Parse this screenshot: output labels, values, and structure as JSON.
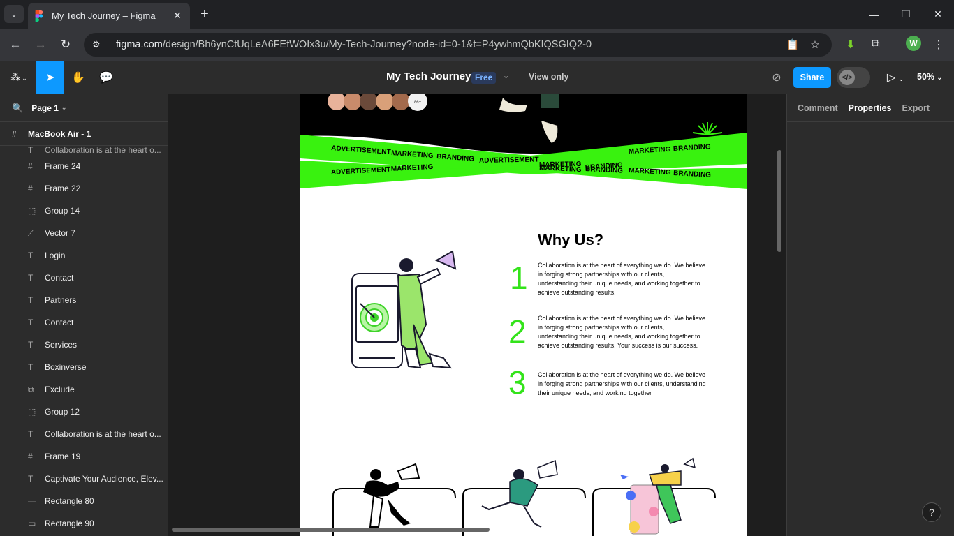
{
  "browser": {
    "tab_title": "My Tech Journey – Figma",
    "url_host": "figma.com",
    "url_path": "/design/Bh6ynCtUqLeA6FEfWOIx3u/My-Tech-Journey?node-id=0-1&t=P4ywhmQbKIQSGIQ2-0",
    "profile_initial": "W"
  },
  "figma": {
    "file_title": "My Tech Journey",
    "plan_badge": "Free",
    "view_mode": "View only",
    "share_label": "Share",
    "zoom": "50%",
    "accent_color": "#0d99ff"
  },
  "left_panel": {
    "page": "Page 1",
    "frame": "MacBook Air - 1",
    "cut_layer": "Collaboration is at the heart o...",
    "layers": [
      {
        "icon": "frame-icon",
        "label": "Frame 24"
      },
      {
        "icon": "frame-icon",
        "label": "Frame 22"
      },
      {
        "icon": "group-icon",
        "label": "Group 14"
      },
      {
        "icon": "vector-icon",
        "label": "Vector 7"
      },
      {
        "icon": "text-icon",
        "label": "Login"
      },
      {
        "icon": "text-icon",
        "label": "Contact"
      },
      {
        "icon": "text-icon",
        "label": "Partners"
      },
      {
        "icon": "text-icon",
        "label": "Contact"
      },
      {
        "icon": "text-icon",
        "label": "Services"
      },
      {
        "icon": "text-icon",
        "label": "Boxinverse"
      },
      {
        "icon": "boolean-icon",
        "label": "Exclude"
      },
      {
        "icon": "group-icon",
        "label": "Group 12"
      },
      {
        "icon": "text-icon",
        "label": "Collaboration is at the heart o..."
      },
      {
        "icon": "frame-icon",
        "label": "Frame 19"
      },
      {
        "icon": "text-icon",
        "label": "Captivate Your Audience, Elev..."
      },
      {
        "icon": "line-icon",
        "label": "Rectangle 80"
      },
      {
        "icon": "rect-icon",
        "label": "Rectangle 90"
      }
    ]
  },
  "right_panel": {
    "tabs": [
      "Comment",
      "Properties",
      "Export"
    ],
    "active_tab": "Properties"
  },
  "design": {
    "avatar_count": "86+",
    "ribbon_words_top": [
      "ADVERTISEMENT",
      "MARKETING",
      "BRANDING",
      "ADVERTISEMENT",
      "MARKETING",
      "BRANDING",
      "MARKETING",
      "BRANDING"
    ],
    "ribbon_words_bottom": [
      "ADVERTISEMENT",
      "MARKETING",
      "MARKETING",
      "BRANDING",
      "MARKETING",
      "BRANDING"
    ],
    "ribbon_color": "#39f20f",
    "heading": "Why Us?",
    "points": [
      {
        "num": "1",
        "text": "Collaboration is at the heart of everything we do. We believe in forging strong partnerships with our clients, understanding their unique needs, and working together to achieve outstanding results."
      },
      {
        "num": "2",
        "text": "Collaboration is at the heart of everything we do. We believe in forging strong partnerships with our clients, understanding their unique needs, and working together to achieve outstanding results. Your success is our success."
      },
      {
        "num": "3",
        "text": "Collaboration is at the heart of everything we do. We believe in forging strong partnerships with our clients, understanding their unique needs, and working together"
      }
    ]
  }
}
